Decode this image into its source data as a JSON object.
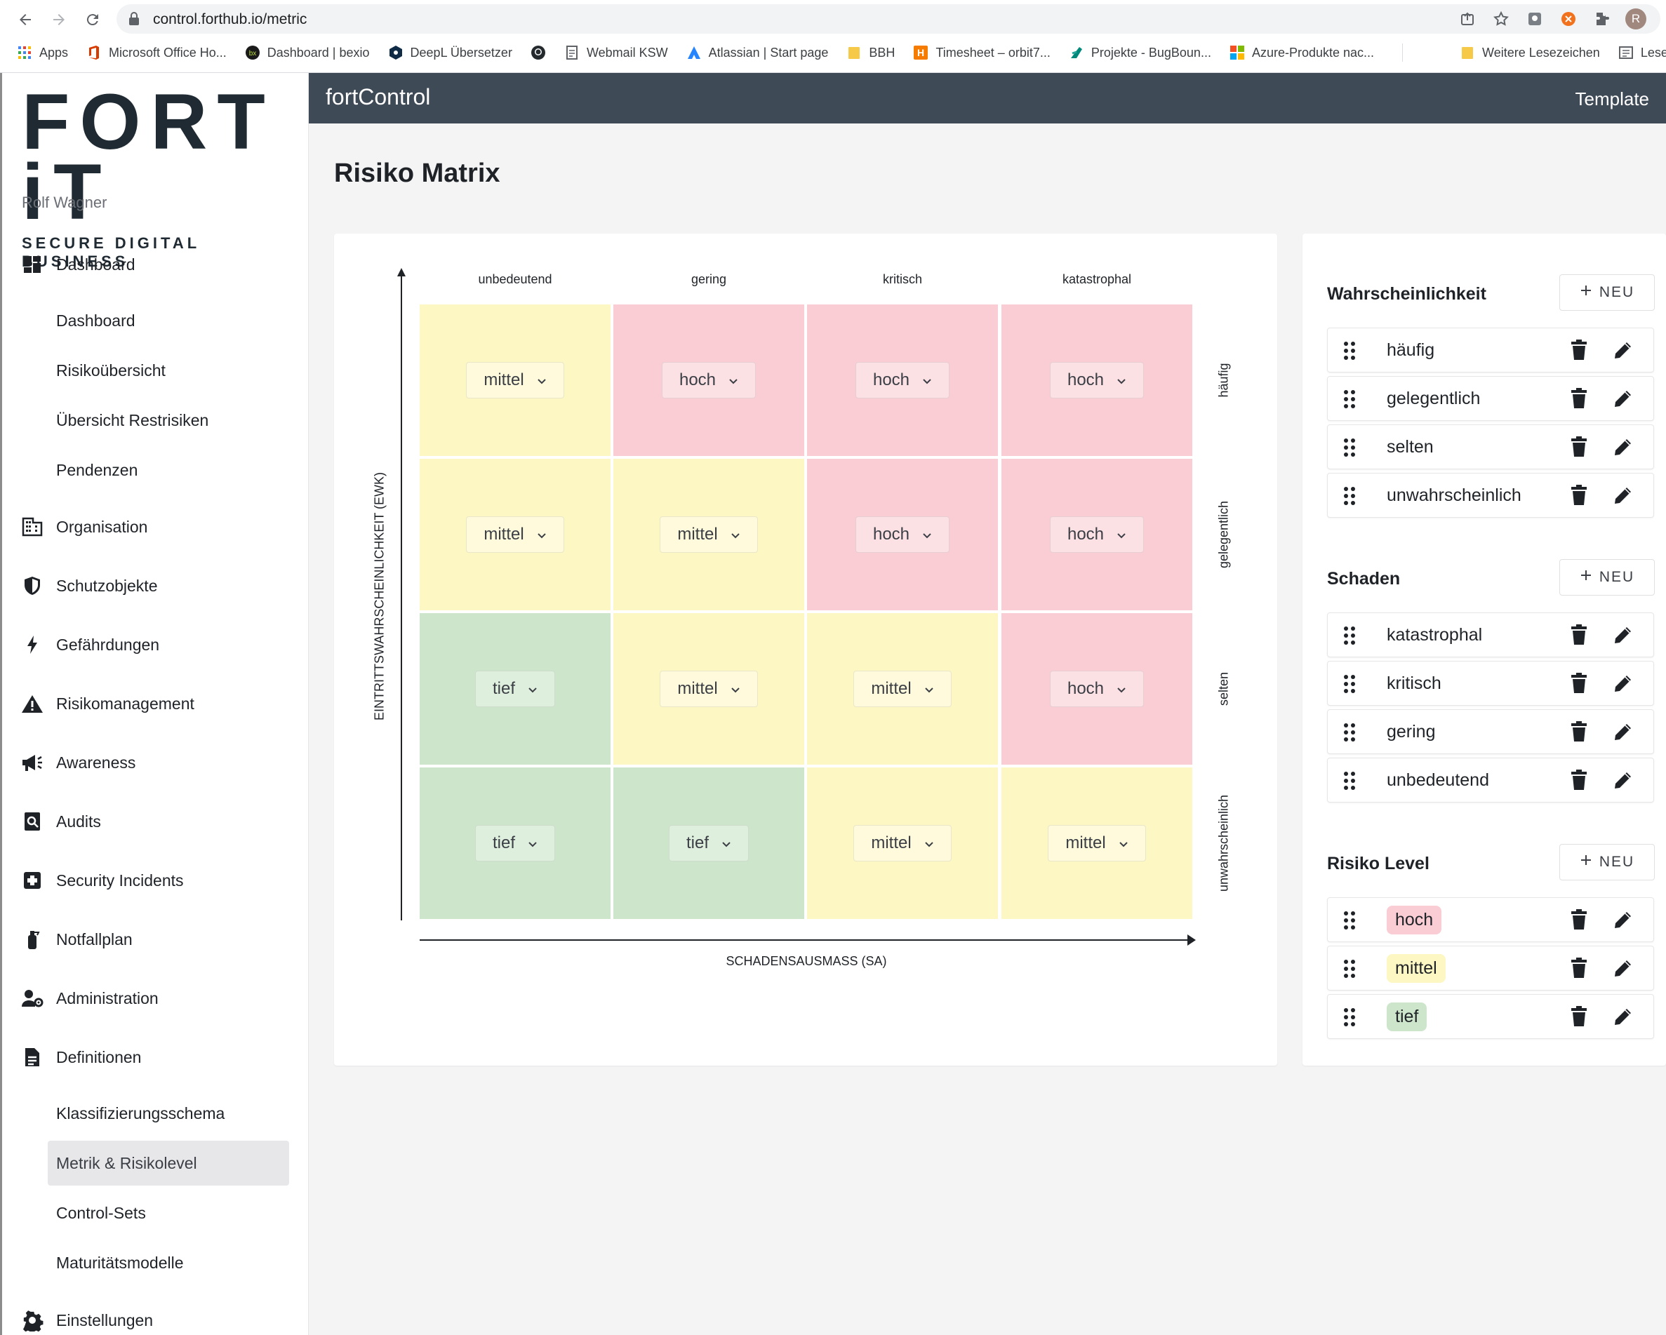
{
  "browser": {
    "url": "control.forthub.io/metric",
    "bookmarks": [
      {
        "label": "Apps",
        "icon": "apps-grid-icon",
        "color": "#4285f4"
      },
      {
        "label": "Microsoft Office Ho...",
        "icon": "office-icon",
        "color": "#d83b01"
      },
      {
        "label": "Dashboard | bexio",
        "icon": "bexio-icon",
        "color": "#1a1a1a"
      },
      {
        "label": "DeepL Übersetzer",
        "icon": "deepl-icon",
        "color": "#0f2b46"
      },
      {
        "label": "",
        "icon": "github-icon",
        "color": "#24292e"
      },
      {
        "label": "Webmail KSW",
        "icon": "page-icon",
        "color": "#5f6368"
      },
      {
        "label": "Atlassian | Start page",
        "icon": "atlassian-icon",
        "color": "#2684ff"
      },
      {
        "label": "BBH",
        "icon": "folder-icon",
        "color": "#f7c948"
      },
      {
        "label": "Timesheet – orbit7...",
        "icon": "timesheet-icon",
        "color": "#f57c00"
      },
      {
        "label": "Projekte - BugBoun...",
        "icon": "bugbounty-icon",
        "color": "#00897b"
      },
      {
        "label": "Azure-Produkte nac...",
        "icon": "microsoft-icon",
        "color": "#f25022"
      },
      {
        "label": "Weitere Lesezeichen",
        "icon": "folder-icon",
        "color": "#f7c948"
      },
      {
        "label": "Lese",
        "icon": "reading-list-icon",
        "color": "#5f6368"
      }
    ],
    "avatar_initial": "R"
  },
  "sidebar": {
    "brand": "FORT iT",
    "brand_sub": "SECURE DIGITAL BUSINESS",
    "user": "Rolf Wagner",
    "items": [
      {
        "label": "Dashboard",
        "icon": "dashboard-icon",
        "level": 0
      },
      {
        "label": "Dashboard",
        "level": 1
      },
      {
        "label": "Risikoübersicht",
        "level": 1
      },
      {
        "label": "Übersicht Restrisiken",
        "level": 1
      },
      {
        "label": "Pendenzen",
        "level": 1
      },
      {
        "label": "Organisation",
        "icon": "building-icon",
        "level": 0
      },
      {
        "label": "Schutzobjekte",
        "icon": "shield-icon",
        "level": 0
      },
      {
        "label": "Gefährdungen",
        "icon": "lightning-icon",
        "level": 0
      },
      {
        "label": "Risikomanagement",
        "icon": "warning-icon",
        "level": 0
      },
      {
        "label": "Awareness",
        "icon": "megaphone-icon",
        "level": 0
      },
      {
        "label": "Audits",
        "icon": "audit-search-icon",
        "level": 0
      },
      {
        "label": "Security Incidents",
        "icon": "medical-cross-icon",
        "level": 0
      },
      {
        "label": "Notfallplan",
        "icon": "fire-extinguisher-icon",
        "level": 0
      },
      {
        "label": "Administration",
        "icon": "user-gear-icon",
        "level": 0
      },
      {
        "label": "Definitionen",
        "icon": "document-icon",
        "level": 0
      },
      {
        "label": "Klassifizierungsschema",
        "level": 1
      },
      {
        "label": "Metrik & Risikolevel",
        "level": 1,
        "active": true
      },
      {
        "label": "Control-Sets",
        "level": 1
      },
      {
        "label": "Maturitätsmodelle",
        "level": 1
      },
      {
        "label": "Einstellungen",
        "icon": "gear-icon",
        "level": 0
      }
    ]
  },
  "header": {
    "app_title": "fortControl",
    "right_label": "Template"
  },
  "page_title": "Risiko Matrix",
  "matrix": {
    "columns": [
      "unbedeutend",
      "gering",
      "kritisch",
      "katastrophal"
    ],
    "rows": [
      "häufig",
      "gelegentlich",
      "selten",
      "unwahrscheinlich"
    ],
    "cells": [
      [
        "mittel",
        "hoch",
        "hoch",
        "hoch"
      ],
      [
        "mittel",
        "mittel",
        "hoch",
        "hoch"
      ],
      [
        "tief",
        "mittel",
        "mittel",
        "hoch"
      ],
      [
        "tief",
        "tief",
        "mittel",
        "mittel"
      ]
    ],
    "y_axis_label": "EINTRITTSWAHRSCHEINLICHKEIT (EWK)",
    "x_axis_label": "SCHADENSAUSMASS (SA)",
    "level_colors": {
      "hoch": "#f9cdd3",
      "mittel": "#fdf7c3",
      "tief": "#cde6cb"
    }
  },
  "panels": {
    "neu_label": "NEU",
    "wahrscheinlichkeit": {
      "title": "Wahrscheinlichkeit",
      "items": [
        "häufig",
        "gelegentlich",
        "selten",
        "unwahrscheinlich"
      ]
    },
    "schaden": {
      "title": "Schaden",
      "items": [
        "katastrophal",
        "kritisch",
        "gering",
        "unbedeutend"
      ]
    },
    "risiko_level": {
      "title": "Risiko Level",
      "items": [
        {
          "label": "hoch",
          "color": "#f9cdd3"
        },
        {
          "label": "mittel",
          "color": "#fdf7c3"
        },
        {
          "label": "tief",
          "color": "#cde6cb"
        }
      ]
    }
  }
}
